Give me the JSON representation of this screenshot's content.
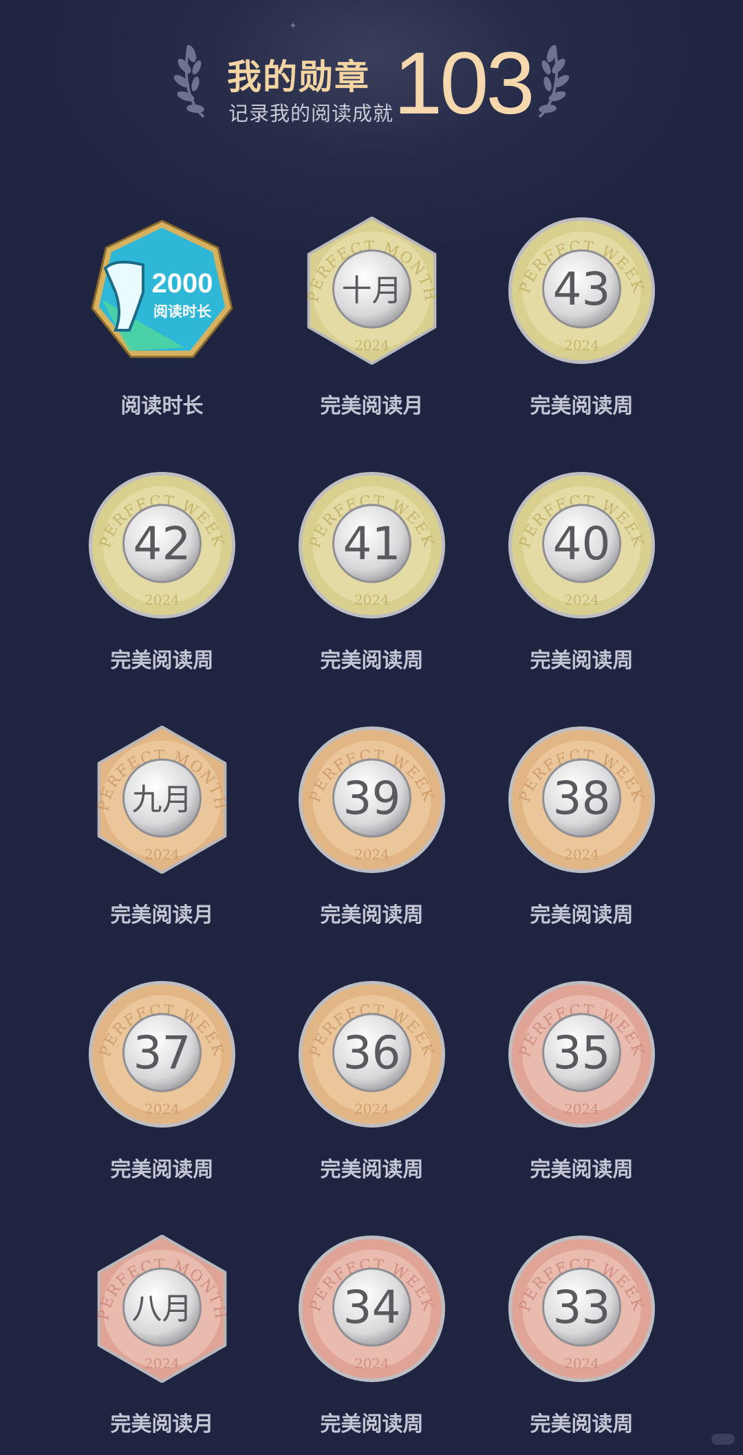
{
  "header": {
    "title": "我的勋章",
    "subtitle": "记录我的阅读成就",
    "count": "103"
  },
  "theme": {
    "background": "#1f2440",
    "title_color": "#f3d4a3",
    "count_color": "#f5d8ad",
    "label_color": "#c3c6d4"
  },
  "medals": [
    {
      "label": "阅读时长",
      "kind": "reading-time",
      "number": "2000",
      "caption": "阅读时长",
      "metal": "teal"
    },
    {
      "label": "完美阅读月",
      "kind": "month",
      "ring_text": "PERFECT MONTH",
      "year": "2024",
      "center": "十月",
      "metal": "gold"
    },
    {
      "label": "完美阅读周",
      "kind": "week",
      "ring_text": "PERFECT WEEK",
      "year": "2024",
      "center": "43",
      "metal": "gold"
    },
    {
      "label": "完美阅读周",
      "kind": "week",
      "ring_text": "PERFECT WEEK",
      "year": "2024",
      "center": "42",
      "metal": "gold"
    },
    {
      "label": "完美阅读周",
      "kind": "week",
      "ring_text": "PERFECT WEEK",
      "year": "2024",
      "center": "41",
      "metal": "gold"
    },
    {
      "label": "完美阅读周",
      "kind": "week",
      "ring_text": "PERFECT WEEK",
      "year": "2024",
      "center": "40",
      "metal": "gold"
    },
    {
      "label": "完美阅读月",
      "kind": "month",
      "ring_text": "PERFECT MONTH",
      "year": "2024",
      "center": "九月",
      "metal": "bronze"
    },
    {
      "label": "完美阅读周",
      "kind": "week",
      "ring_text": "PERFECT WEEK",
      "year": "2024",
      "center": "39",
      "metal": "bronze"
    },
    {
      "label": "完美阅读周",
      "kind": "week",
      "ring_text": "PERFECT WEEK",
      "year": "2024",
      "center": "38",
      "metal": "bronze"
    },
    {
      "label": "完美阅读周",
      "kind": "week",
      "ring_text": "PERFECT WEEK",
      "year": "2024",
      "center": "37",
      "metal": "bronze"
    },
    {
      "label": "完美阅读周",
      "kind": "week",
      "ring_text": "PERFECT WEEK",
      "year": "2024",
      "center": "36",
      "metal": "bronze"
    },
    {
      "label": "完美阅读周",
      "kind": "week",
      "ring_text": "PERFECT WEEK",
      "year": "2024",
      "center": "35",
      "metal": "rose"
    },
    {
      "label": "完美阅读月",
      "kind": "month",
      "ring_text": "PERFECT MONTH",
      "year": "2024",
      "center": "八月",
      "metal": "rose"
    },
    {
      "label": "完美阅读周",
      "kind": "week",
      "ring_text": "PERFECT WEEK",
      "year": "2024",
      "center": "34",
      "metal": "rose"
    },
    {
      "label": "完美阅读周",
      "kind": "week",
      "ring_text": "PERFECT WEEK",
      "year": "2024",
      "center": "33",
      "metal": "rose"
    }
  ]
}
